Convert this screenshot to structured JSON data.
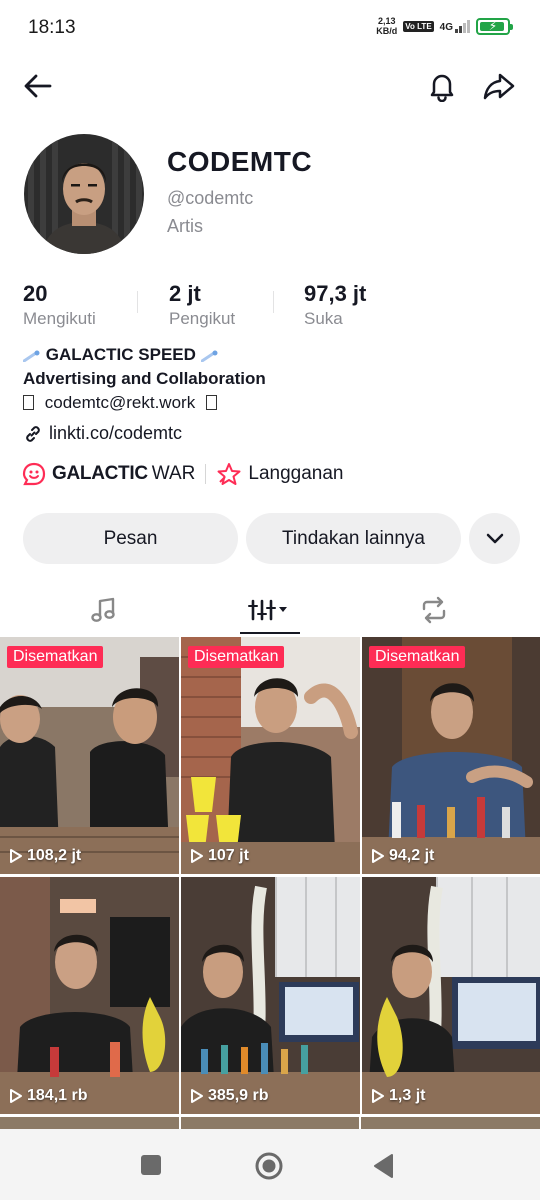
{
  "status_bar": {
    "time": "18:13",
    "speed_value": "2,13",
    "speed_unit": "KB/d",
    "volte": "Vo LTE",
    "network": "4G"
  },
  "profile": {
    "name": "CODEMTC",
    "handle": "@codemtc",
    "category": "Artis",
    "stats": [
      {
        "value": "20",
        "label": "Mengikuti"
      },
      {
        "value": "2 jt",
        "label": "Pengikut"
      },
      {
        "value": "97,3 jt",
        "label": "Suka"
      }
    ],
    "bio_line1": "GALACTIC SPEED",
    "bio_line2": "Advertising and Collaboration",
    "bio_email": "codemtc@rekt.work",
    "link": "linkti.co/codemtc",
    "badge_game_bold": "GALACTIC",
    "badge_game_regular": "WAR",
    "badge_subscribe": "Langganan"
  },
  "actions": {
    "message": "Pesan",
    "more": "Tindakan lainnya"
  },
  "colors": {
    "accent": "#fe2c55",
    "text_secondary": "#8a8b91",
    "button_bg": "#efeff0",
    "battery": "#22a447"
  },
  "videos": [
    {
      "pinned_label": "Disematkan",
      "views": "108,2 jt"
    },
    {
      "pinned_label": "Disematkan",
      "views": "107 jt"
    },
    {
      "pinned_label": "Disematkan",
      "views": "94,2 jt"
    },
    {
      "pinned_label": "",
      "views": "184,1 rb"
    },
    {
      "pinned_label": "",
      "views": "385,9 rb"
    },
    {
      "pinned_label": "",
      "views": "1,3 jt"
    }
  ]
}
